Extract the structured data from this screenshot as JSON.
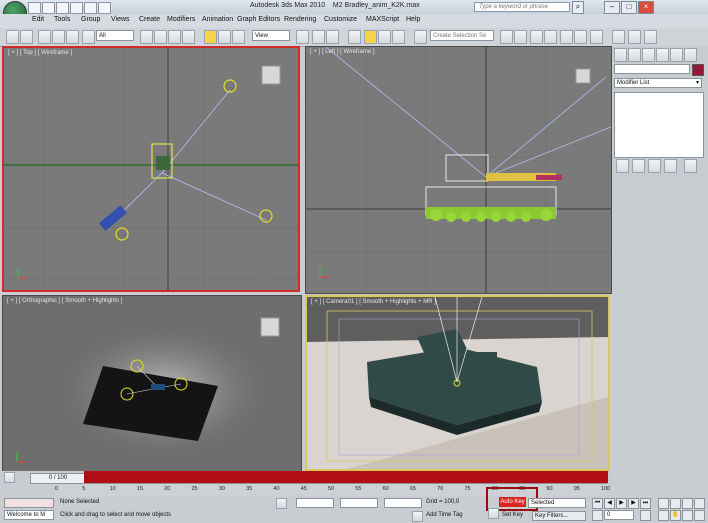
{
  "window": {
    "title": "Autodesk 3ds Max 2010",
    "file": "M2 Bradley_anim_K2K.max",
    "help_search_placeholder": "Type a keyword or phrase"
  },
  "menu": [
    "Edit",
    "Tools",
    "Group",
    "Views",
    "Create",
    "Modifiers",
    "Animation",
    "Graph Editors",
    "Rendering",
    "Customize",
    "MAXScript",
    "Help"
  ],
  "toolbar": {
    "filter_select": "All",
    "ref_coord_select": "View",
    "named_selection_placeholder": "Create Selection Se"
  },
  "viewports": {
    "top": "[ + ] [ Top ] [ Wireframe ]",
    "left": "[ + ] [ Left ] [ Wireframe ]",
    "ortho": "[ + ] [ Orthographic ] [ Smooth + Highlights ]",
    "camera": "[ + ] [ Camera01 ] [ Smooth + Highlights + MR ]"
  },
  "command_panel": {
    "modifier_list": "Modifier List"
  },
  "timeline": {
    "slider": "0 / 100",
    "ticks": [
      "0",
      "5",
      "10",
      "15",
      "20",
      "25",
      "30",
      "35",
      "40",
      "45",
      "50",
      "55",
      "60",
      "65",
      "70",
      "75",
      "80",
      "85",
      "90",
      "95",
      "100"
    ]
  },
  "status": {
    "welcome": "Welcome to M",
    "selection": "None Selected",
    "prompt": "Click and drag to select and move objects",
    "grid": "Grid = 100,0",
    "add_time_tag": "Add Time Tag",
    "auto_key": "Auto Key",
    "selected": "Selected",
    "set_key": "Set Key",
    "key_filters": "Key Filters...",
    "frame": "0"
  },
  "colors": {
    "accent": "#b00e14",
    "autokey": "#dd2222"
  }
}
